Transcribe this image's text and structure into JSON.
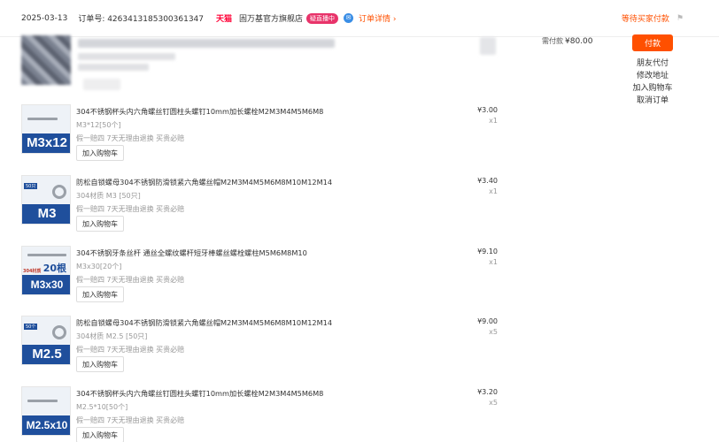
{
  "order": {
    "date": "2025-03-13",
    "order_no": "订单号: 4263413185300361347",
    "platform": "天猫",
    "shop": "固万基官方旗舰店",
    "badge": "疑直播中",
    "detail_link": "订单详情 ›",
    "status": "等待买家付款"
  },
  "payment": {
    "label": "需付款",
    "amount": "¥80.00"
  },
  "actions": {
    "pay": "付款",
    "friend_pay": "朋友代付",
    "modify_address": "修改地址",
    "add_cart": "加入购物车",
    "cancel": "取消订单"
  },
  "icons": {
    "wangwang": "wangwang-chat-icon",
    "flag": "flag-icon"
  },
  "colors": {
    "accent": "#ff5000",
    "tmall": "#ff0036",
    "badge": "#e8336a",
    "image_blue": "#1f4f9c"
  },
  "items": [
    {
      "title": "304不锈钢杯头内六角螺丝钉圆柱头螺钉10mm加长螺栓M2M3M4M5M6M8",
      "sku": "M3*12[50个]",
      "guarantee": "假一赔四 7天无理由退换 买贵必赔",
      "add_cart": "加入购物车",
      "price": "¥3.00",
      "quantity": "x1",
      "image_label": "M3x12"
    },
    {
      "title": "防松自锁螺母304不锈钢防滑锁紧六角螺丝帽M2M3M4M5M6M8M10M12M14",
      "sku": "304材质 M3 [50只]",
      "guarantee": "假一赔四 7天无理由退换 买贵必赔",
      "add_cart": "加入购物车",
      "price": "¥3.40",
      "quantity": "x1",
      "image_label": "M3",
      "image_qty": "50只"
    },
    {
      "title": "304不锈钢牙条丝杆 通丝全螺纹螺杆短牙棒螺丝螺栓螺柱M5M6M8M10",
      "sku": "M3x30[20个]",
      "guarantee": "假一赔四 7天无理由退换 买贵必赔",
      "add_cart": "加入购物车",
      "price": "¥9.10",
      "quantity": "x1",
      "image_label": "M3x30",
      "image_material": "304材质",
      "image_pcs": "20根"
    },
    {
      "title": "防松自锁螺母304不锈钢防滑锁紧六角螺丝帽M2M3M4M5M6M8M10M12M14",
      "sku": "304材质 M2.5 [50只]",
      "guarantee": "假一赔四 7天无理由退换 买贵必赔",
      "add_cart": "加入购物车",
      "price": "¥9.00",
      "quantity": "x5",
      "image_label": "M2.5",
      "image_qty": "50个"
    },
    {
      "title": "304不锈钢杯头内六角螺丝钉圆柱头螺钉10mm加长螺栓M2M3M4M5M6M8",
      "sku": "M2.5*10[50个]",
      "guarantee": "假一赔四 7天无理由退换 买贵必赔",
      "add_cart": "加入购物车",
      "price": "¥3.20",
      "quantity": "x5",
      "image_label": "M2.5x10"
    }
  ]
}
